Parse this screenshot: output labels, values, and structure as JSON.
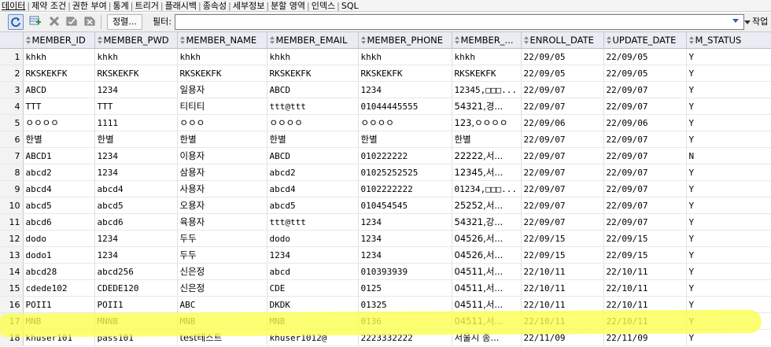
{
  "tabs": [
    "데이터",
    "제약 조건",
    "권한 부여",
    "통계",
    "트리거",
    "플래시백",
    "종속성",
    "세부정보",
    "분할 영역",
    "인덱스",
    "SQL"
  ],
  "toolbar": {
    "sort_label": "정렬...",
    "filter_label": "필터:",
    "filter_value": "",
    "actions_label": "작업"
  },
  "columns": [
    "MEMBER_ID",
    "MEMBER_PWD",
    "MEMBER_NAME",
    "MEMBER_EMAIL",
    "MEMBER_PHONE",
    "MEMBER_...",
    "ENROLL_DATE",
    "UPDATE_DATE",
    "M_STATUS"
  ],
  "rows": [
    {
      "n": "1",
      "c": [
        "khkh",
        "khkh",
        "khkh",
        "khkh",
        "khkh",
        "khkh",
        "22/09/05",
        "22/09/05",
        "Y"
      ]
    },
    {
      "n": "2",
      "c": [
        "RKSKEKFK",
        "RKSKEKFK",
        "RKSKEKFK",
        "RKSKEKFK",
        "RKSKEKFK",
        "RKSKEKFK",
        "22/09/05",
        "22/09/05",
        "Y"
      ]
    },
    {
      "n": "3",
      "c": [
        "ABCD",
        "1234",
        "일용자",
        "ABCD",
        "1234",
        "12345,□□□...",
        "22/09/07",
        "22/09/07",
        "Y"
      ]
    },
    {
      "n": "4",
      "c": [
        "TTT",
        "TTT",
        "티티티",
        "ttt@ttt",
        "01044445555",
        "54321,경...",
        "22/09/07",
        "22/09/07",
        "Y"
      ]
    },
    {
      "n": "5",
      "c": [
        "ㅇㅇㅇㅇ",
        "1111",
        "ㅇㅇㅇ",
        "ㅇㅇㅇㅇ",
        "ㅇㅇㅇㅇ",
        "123,ㅇㅇㅇㅇ",
        "22/09/06",
        "22/09/06",
        "Y"
      ]
    },
    {
      "n": "6",
      "c": [
        "한별",
        "한별",
        "한별",
        "한별",
        "한별",
        "한별",
        "22/09/07",
        "22/09/07",
        "Y"
      ]
    },
    {
      "n": "7",
      "c": [
        "ABCD1",
        "1234",
        "이용자",
        "ABCD",
        "010222222",
        "22222,서...",
        "22/09/07",
        "22/09/07",
        "N"
      ]
    },
    {
      "n": "8",
      "c": [
        "abcd2",
        "1234",
        "삼용자",
        "abcd2",
        "01025252525",
        "12345,서...",
        "22/09/07",
        "22/09/07",
        "Y"
      ]
    },
    {
      "n": "9",
      "c": [
        "abcd4",
        "abcd4",
        "사용자",
        "abcd4",
        "0102222222",
        "01234,□□□...",
        "22/09/07",
        "22/09/07",
        "Y"
      ]
    },
    {
      "n": "10",
      "c": [
        "abcd5",
        "abcd5",
        "오용자",
        "abcd5",
        "010454545",
        "25252,서...",
        "22/09/07",
        "22/09/07",
        "Y"
      ]
    },
    {
      "n": "11",
      "c": [
        "abcd6",
        "abcd6",
        "육용자",
        "ttt@ttt",
        "1234",
        "54321,강...",
        "22/09/07",
        "22/09/07",
        "Y"
      ]
    },
    {
      "n": "12",
      "c": [
        "dodo",
        "1234",
        "두두",
        "dodo",
        "1234",
        "04526,서...",
        "22/09/15",
        "22/09/15",
        "Y"
      ]
    },
    {
      "n": "13",
      "c": [
        "dodo1",
        "1234",
        "두두",
        "1234",
        "1234",
        "04526,서...",
        "22/09/15",
        "22/09/15",
        "Y"
      ]
    },
    {
      "n": "14",
      "c": [
        "abcd28",
        "abcd256",
        "신은정",
        "abcd",
        "010393939",
        "04511,서...",
        "22/10/11",
        "22/10/11",
        "Y"
      ]
    },
    {
      "n": "15",
      "c": [
        "cdede102",
        "CDEDE120",
        "신은정",
        "CDE",
        "0125",
        "04511,서...",
        "22/10/11",
        "22/10/11",
        "Y"
      ]
    },
    {
      "n": "16",
      "c": [
        "POII1",
        "POII1",
        "ABC",
        "DKDK",
        "01325",
        "04511,서...",
        "22/10/11",
        "22/10/11",
        "Y"
      ]
    },
    {
      "n": "17",
      "c": [
        "MNB",
        "MNNB",
        "MNB",
        "MNB",
        "0136",
        "04511,서...",
        "22/10/11",
        "22/10/11",
        "Y"
      ]
    },
    {
      "n": "18",
      "c": [
        "khuser101",
        "pass101",
        "test테스트",
        "khuser1012@",
        "2223332222",
        "서울시 종...",
        "22/11/09",
        "22/11/09",
        "Y"
      ]
    }
  ],
  "highlight_color": "#fbff4a"
}
